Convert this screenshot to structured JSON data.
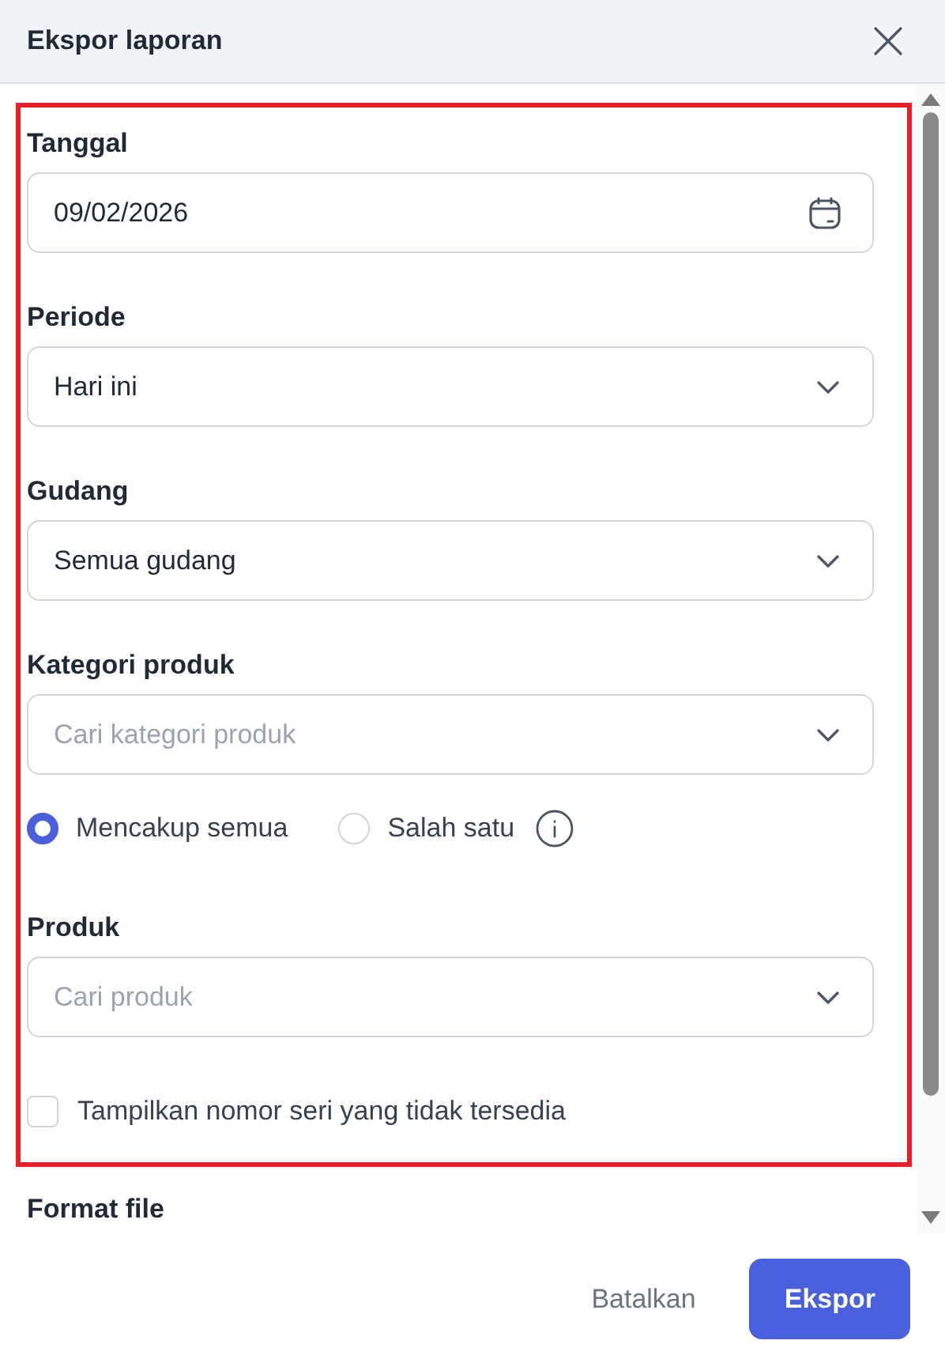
{
  "dialog": {
    "title": "Ekspor laporan"
  },
  "sections": [
    {
      "kind": "date_field",
      "label": "Tanggal",
      "value": "09/02/2026"
    },
    {
      "kind": "select_field",
      "label": "Periode",
      "value": "Hari ini"
    },
    {
      "kind": "select_field",
      "label": "Gudang",
      "value": "Semua gudang"
    },
    {
      "kind": "select_field",
      "label": "Kategori produk",
      "placeholder": "Cari kategori produk"
    },
    {
      "kind": "radios",
      "options": [
        {
          "label": "Mencakup semua",
          "selected": true
        },
        {
          "label": "Salah satu",
          "selected": false
        }
      ],
      "info": true
    },
    {
      "kind": "select_field",
      "label": "Produk",
      "placeholder": "Cari produk"
    },
    {
      "kind": "checkbox",
      "label": "Tampilkan nomor seri yang tidak tersedia",
      "checked": false
    }
  ],
  "after_frame": {
    "label": "Format file"
  },
  "buttons": [
    {
      "label": "Batalkan",
      "kind": "secondary"
    },
    {
      "label": "Ekspor",
      "kind": "primary"
    }
  ]
}
